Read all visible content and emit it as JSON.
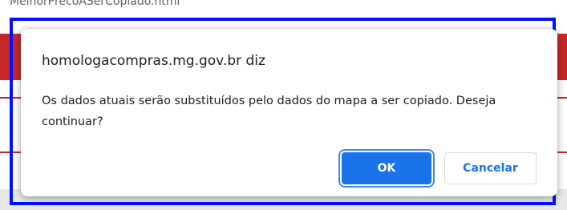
{
  "background": {
    "tab_title": "MelhorPrecoASerCopiado.html"
  },
  "dialog": {
    "title": "homologacompras.mg.gov.br diz",
    "message": "Os dados atuais serão substituídos pelo dados do mapa a ser copiado. Deseja continuar?",
    "ok_label": "OK",
    "cancel_label": "Cancelar"
  },
  "colors": {
    "accent": "#1a73e8",
    "background_red": "#c62828",
    "focus_outline": "#0010ff"
  }
}
